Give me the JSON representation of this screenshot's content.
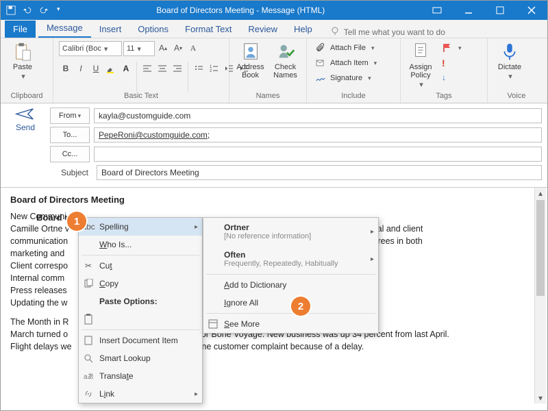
{
  "title": "Board of Directors Meeting  -  Message (HTML)",
  "tabs": {
    "file": "File",
    "message": "Message",
    "insert": "Insert",
    "options": "Options",
    "format": "Format Text",
    "review": "Review",
    "help": "Help",
    "tell": "Tell me what you want to do"
  },
  "groups": {
    "clipboard": "Clipboard",
    "basic": "Basic Text",
    "names": "Names",
    "include": "Include",
    "tags": "Tags",
    "voice": "Voice"
  },
  "ribbon": {
    "paste": "Paste",
    "font": "Calibri (Boc",
    "size": "11",
    "address": "Address Book",
    "check": "Check Names",
    "attachFile": "Attach File",
    "attachItem": "Attach Item",
    "signature": "Signature",
    "assign": "Assign Policy",
    "dictate": "Dictate"
  },
  "send": "Send",
  "fields": {
    "from": "From",
    "to": "To...",
    "cc": "Cc...",
    "subject": "Subject",
    "fromVal": "kayla@customguide.com",
    "toVal": "PepeRoni@customguide.com;",
    "ccVal": "",
    "subjectVal": "Board of Directors Meeting"
  },
  "body": {
    "heading": "Board of Directors Meeting",
    "p1a": "New Communi",
    "p2a": "Camille Ortne v",
    "p2b": "formal internal and client",
    "p3a": "communication",
    "p3b": ", Inc. and has degrees in both",
    "p4": "marketing and",
    "p5": "Client correspo",
    "p6": "Internal comm",
    "p7": "Press releases",
    "p8": "Updating the w",
    "p9": "The Month in R",
    "p10": "March turned o",
    "p10b": "ductive month for Bone Voyage. New business was up 34 percent from last April.",
    "p11": "Flight delays we",
    "p11b": "eceived only one customer complaint because of a delay."
  },
  "ctx1": {
    "spelling": "Spelling",
    "who": "Who Is...",
    "cut": "Cut",
    "copy": "Copy",
    "pasteOpt": "Paste Options:",
    "insertDoc": "Insert Document Item",
    "smart": "Smart Lookup",
    "translate": "Translate",
    "link": "Link"
  },
  "ctx2": {
    "ortner": "Ortner",
    "ortnerSub": "[No reference information]",
    "often": "Often",
    "oftenSub": "Frequently, Repeatedly, Habitually",
    "addDict": "Add to Dictionary",
    "ignore": "Ignore All",
    "seeMore": "See More"
  },
  "badges": {
    "b1": "1",
    "b2": "2"
  }
}
